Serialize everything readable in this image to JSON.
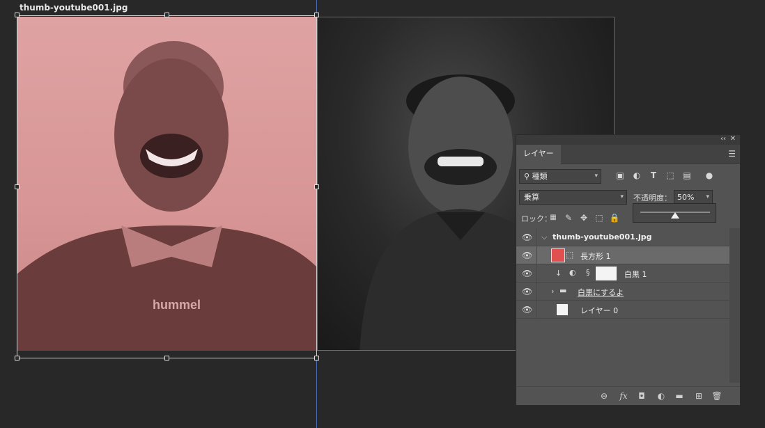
{
  "document": {
    "title": "thumb-youtube001.jpg"
  },
  "artwork": {
    "tint_color": "#dfa2a2",
    "shirt_text": "hummel"
  },
  "panel": {
    "collapse_icon": "double-chevron-icon",
    "close_icon": "close-icon",
    "tab_label": "レイヤー",
    "filter": {
      "value": "種類",
      "icon": "search-icon"
    },
    "filter_icons": [
      "image-filter-icon",
      "adjustment-filter-icon",
      "type-filter-icon",
      "shape-filter-icon",
      "smart-object-filter-icon",
      "toggle-filter-icon"
    ],
    "blend_mode": "乗算",
    "opacity_label": "不透明度：",
    "opacity_value": "50%",
    "opacity_percent": 50,
    "lock_label": "ロック：",
    "lock_icons": [
      "lock-transparent-icon",
      "lock-paint-icon",
      "lock-move-icon",
      "lock-artboard-icon",
      "lock-all-icon"
    ],
    "layers": [
      {
        "name": "thumb-youtube001.jpg",
        "type": "artboard",
        "expanded": true
      },
      {
        "name": "長方形 1",
        "type": "shape",
        "selected": true,
        "color": "#e05050"
      },
      {
        "name": "白黒 1",
        "type": "adjustment",
        "clipped": true
      },
      {
        "name": "白黒にするよ",
        "type": "group",
        "expanded": false
      },
      {
        "name": "レイヤー 0",
        "type": "pixel"
      }
    ],
    "bottom_icons": [
      "link-icon",
      "fx-icon",
      "mask-icon",
      "new-adjustment-icon",
      "folder-icon",
      "new-layer-icon",
      "trash-icon"
    ]
  }
}
